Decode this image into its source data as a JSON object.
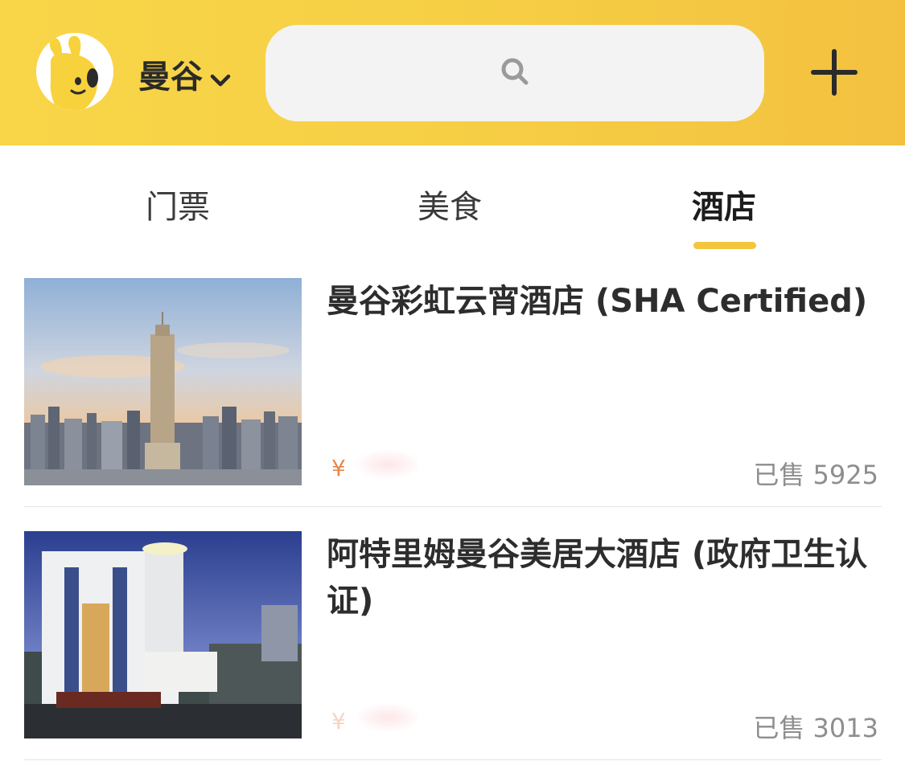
{
  "header": {
    "city": "曼谷",
    "search_placeholder": "",
    "avatar_icon": "mascot-avatar-icon",
    "add_icon": "plus-icon",
    "search_icon": "search-icon",
    "city_dropdown_icon": "chevron-down-icon",
    "colors": {
      "header_bg": "#f6cf45",
      "search_bg": "#f3f3f3"
    }
  },
  "tabs": [
    {
      "label": "门票",
      "active": false
    },
    {
      "label": "美食",
      "active": false
    },
    {
      "label": "酒店",
      "active": true
    }
  ],
  "accent_color": "#f3c640",
  "hotels": [
    {
      "name": "曼谷彩虹云宵酒店 (SHA Certified)",
      "price_symbol": "¥",
      "sold": "已售 5925"
    },
    {
      "name": "阿特里姆曼谷美居大酒店 (政府卫生认证)",
      "price_symbol": "¥",
      "sold": "已售 3013"
    }
  ]
}
